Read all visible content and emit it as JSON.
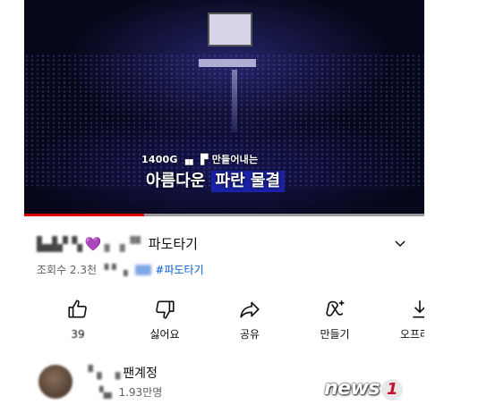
{
  "video": {
    "caption_line1": "1400G ▗▖ ▛ 만들어내는",
    "caption_line2_prefix": "아름다운 ",
    "caption_line2_highlight": "파란 물결",
    "progress_fraction": 0.3
  },
  "title": {
    "blurred_prefix": "▙▟▞ ▚",
    "heart": "💜",
    "blurred_mid": "▖▗▝▘",
    "text": "파도타기"
  },
  "meta": {
    "views": "조회수 2.3천",
    "blurred": "▝ ▘ ▖",
    "hashtag": "#파도타기"
  },
  "actions": {
    "like_count": "39",
    "dislike_label": "싫어요",
    "share_label": "공유",
    "remix_label": "만들기",
    "download_label": "오프라인"
  },
  "channel": {
    "blurred_name": "▝ ▖ ▗",
    "name_suffix": "팬계정",
    "blurred_subs": "▚▖",
    "subscribers": "1.93만명"
  },
  "watermark": {
    "text": "news",
    "number": "1"
  },
  "colors": {
    "progress": "#e00000",
    "hashtag": "#065fd4",
    "caption_highlight": "#1a23a8"
  }
}
